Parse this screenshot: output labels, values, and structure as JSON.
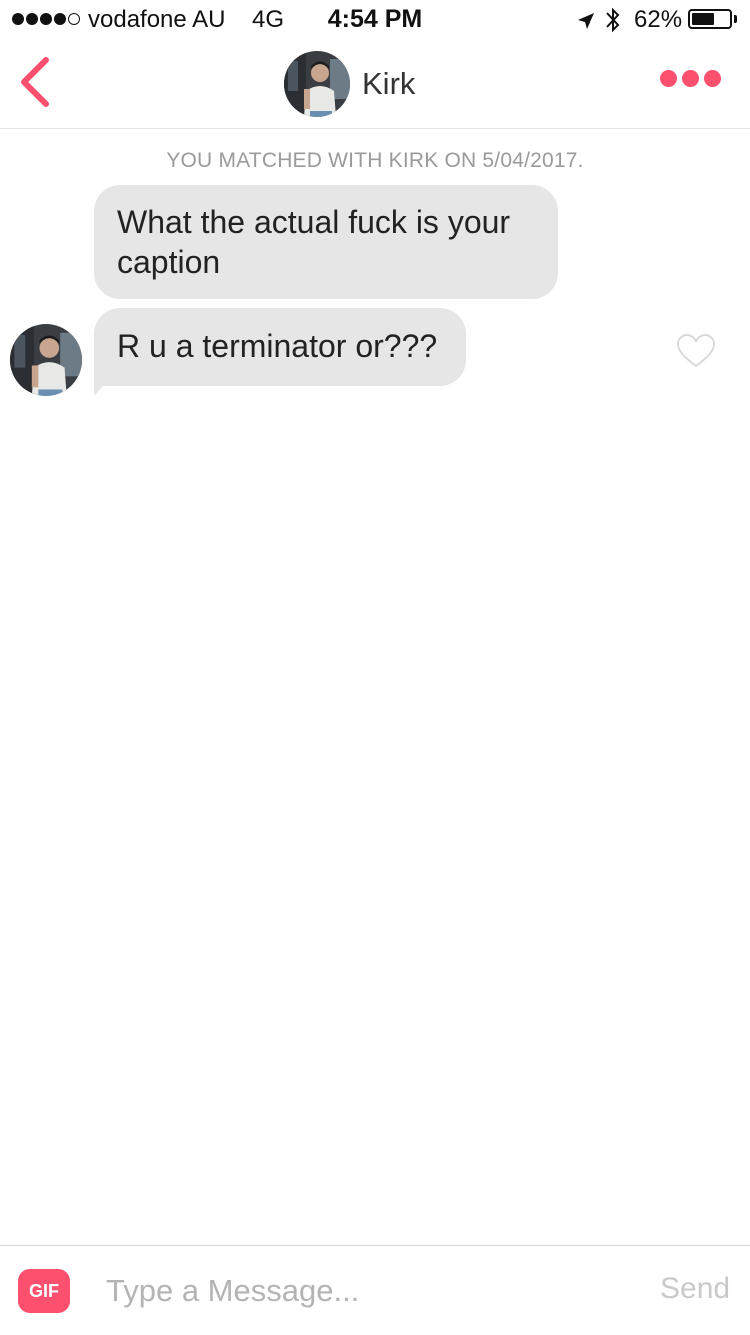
{
  "status_bar": {
    "carrier": "vodafone AU",
    "network": "4G",
    "time": "4:54 PM",
    "battery": "62%",
    "battery_level": 0.62,
    "signal_bars_filled": 4,
    "signal_bars_total": 5
  },
  "header": {
    "match_name": "Kirk",
    "back_icon": "chevron-left-icon",
    "more_icon": "three-dots-icon"
  },
  "chat": {
    "match_banner": "YOU MATCHED WITH KIRK ON 5/04/2017.",
    "messages": [
      {
        "text": "What the actual fuck is your caption"
      },
      {
        "text": "R u a terminator or???"
      }
    ],
    "like_icon": "heart-outline-icon"
  },
  "composer": {
    "gif_label": "GIF",
    "placeholder": "Type a Message...",
    "value": "",
    "send_label": "Send"
  },
  "colors": {
    "accent": "#fd4f6e",
    "bubble": "#e6e6e6",
    "muted_text": "#9a9a9a",
    "divider": "#e3e3e3"
  }
}
